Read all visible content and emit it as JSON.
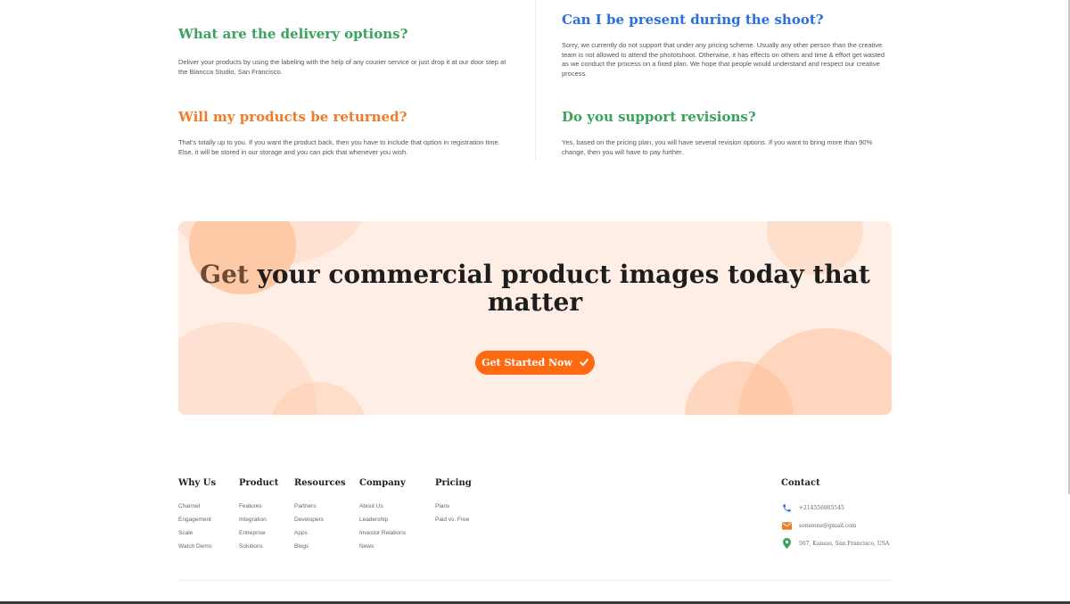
{
  "faq": {
    "items": [
      {
        "question": "What are the delivery options?",
        "answer": "Deliver your products by using the labeling with the help of any courier service or just drop it at our door step at the Biancca Studio, San Francisco.",
        "color": "#3aa35c"
      },
      {
        "question": "Can I be present during the shoot?",
        "answer": "Sorry, we currently do not support that under any pricing scheme. Usually any other person than the creative team is not allowed to attend the phototshoot. Otherwise, it has effects on others and time & effort get wasted as we conduct the process on a fixed plan. We hope that people would understand and respect our creative process.",
        "color": "#2a6fdb"
      },
      {
        "question": "Will my products be returned?",
        "answer": "That's totally up to you. If you want the product back, then you have to include that option in registration time. Else, it will be stored in our storage and you can pick that whenever you wish.",
        "color": "#f07b2b"
      },
      {
        "question": "Do you support revisions?",
        "answer": "Yes, based on the pricing plan, you will have several revision options. If you want to bring more than 90% change, then you will have to pay further.",
        "color": "#3aa35c"
      }
    ]
  },
  "cta": {
    "title_highlight": "Get",
    "title_rest": " your commercial product images today that matter",
    "button_label": "Get Started Now",
    "button_icon": "check-icon",
    "background": "#ffeee6",
    "accent": "#ff6a13"
  },
  "footer": {
    "columns": [
      {
        "title": "Why Us",
        "links": [
          "Channel",
          "Engagement",
          "Scale",
          "Watch Demo"
        ]
      },
      {
        "title": "Product",
        "links": [
          "Features",
          "Integration",
          "Entreprise",
          "Solutions"
        ]
      },
      {
        "title": "Resources",
        "links": [
          "Partners",
          "Developers",
          "Apps",
          "Blogs"
        ]
      },
      {
        "title": "Company",
        "links": [
          "About Us",
          "Leadership",
          "Investor Relations",
          "News"
        ]
      },
      {
        "title": "Pricing",
        "links": [
          "Plans",
          "Paid vs. Free"
        ]
      }
    ],
    "contact": {
      "title": "Contact",
      "phone": "+214556905545",
      "email": "someone@gmail.com",
      "address": "567, Kansas, San Francisco, USA",
      "icons": [
        "phone-icon",
        "mail-icon",
        "location-pin-icon"
      ],
      "icon_colors": [
        "#2a6fdb",
        "#f07b2b",
        "#3aa35c"
      ]
    }
  }
}
